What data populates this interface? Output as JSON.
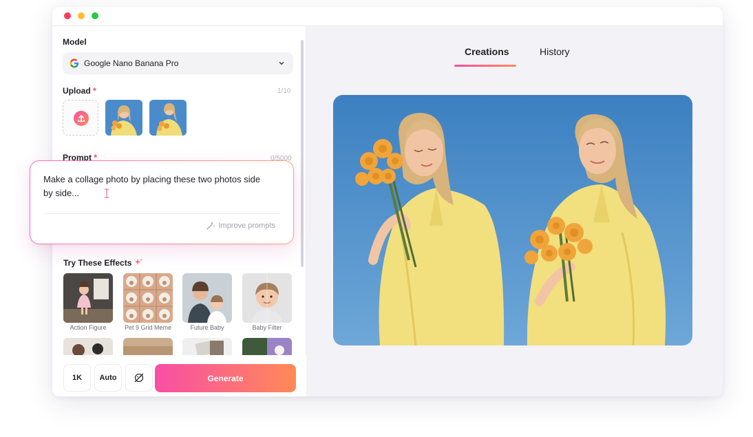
{
  "window": {
    "controls": [
      "close",
      "minimize",
      "maximize"
    ]
  },
  "left_panel": {
    "model": {
      "label": "Model",
      "selected": "Google Nano Banana Pro",
      "icon": "google-icon"
    },
    "upload": {
      "label": "Upload",
      "required_mark": "*",
      "counter": "1/10"
    },
    "prompt": {
      "label": "Prompt",
      "required_mark": "*",
      "counter": "0/5000",
      "value": "Make a collage photo by placing these two photos side by side...",
      "improve_label": "Improve prompts"
    },
    "effects": {
      "title": "Try These Effects",
      "items": [
        {
          "label": "Action Figure"
        },
        {
          "label": "Pet 9 Grid Meme"
        },
        {
          "label": "Future Baby"
        },
        {
          "label": "Baby Filter"
        }
      ]
    },
    "bottom": {
      "resolution": "1K",
      "ratio": "Auto",
      "generate_label": "Generate"
    }
  },
  "right_panel": {
    "tabs": [
      {
        "label": "Creations",
        "active": true
      },
      {
        "label": "History",
        "active": false
      }
    ]
  },
  "colors": {
    "accent_start": "#f84ea5",
    "accent_end": "#ff8a57",
    "required": "#ff3b5c",
    "sky": "#4b8fcb",
    "shirt": "#f2df7e",
    "rose": "#f0a53a"
  }
}
